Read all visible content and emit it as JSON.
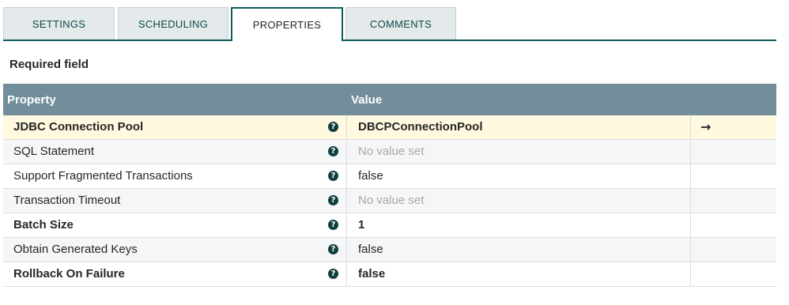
{
  "tabs": [
    {
      "label": "SETTINGS",
      "active": false
    },
    {
      "label": "SCHEDULING",
      "active": false
    },
    {
      "label": "PROPERTIES",
      "active": true
    },
    {
      "label": "COMMENTS",
      "active": false
    }
  ],
  "required_label": "Required field",
  "table": {
    "columns": {
      "property": "Property",
      "value": "Value"
    },
    "rows": [
      {
        "property": "JDBC Connection Pool",
        "value": "DBCPConnectionPool",
        "required": true,
        "empty": false,
        "selected": true,
        "goto_icon": "arrow-right-icon"
      },
      {
        "property": "SQL Statement",
        "value": "No value set",
        "required": false,
        "empty": true,
        "selected": false
      },
      {
        "property": "Support Fragmented Transactions",
        "value": "false",
        "required": false,
        "empty": false,
        "selected": false
      },
      {
        "property": "Transaction Timeout",
        "value": "No value set",
        "required": false,
        "empty": true,
        "selected": false
      },
      {
        "property": "Batch Size",
        "value": "1",
        "required": true,
        "empty": false,
        "selected": false
      },
      {
        "property": "Obtain Generated Keys",
        "value": "false",
        "required": false,
        "empty": false,
        "selected": false
      },
      {
        "property": "Rollback On Failure",
        "value": "false",
        "required": true,
        "empty": false,
        "selected": false
      }
    ]
  },
  "icons": {
    "help": "?",
    "goto": "→"
  },
  "colors": {
    "header_bg": "#728e9b",
    "accent": "#0f5c5c",
    "selected_row": "#fffadf",
    "empty_value": "#a8a8a8"
  }
}
